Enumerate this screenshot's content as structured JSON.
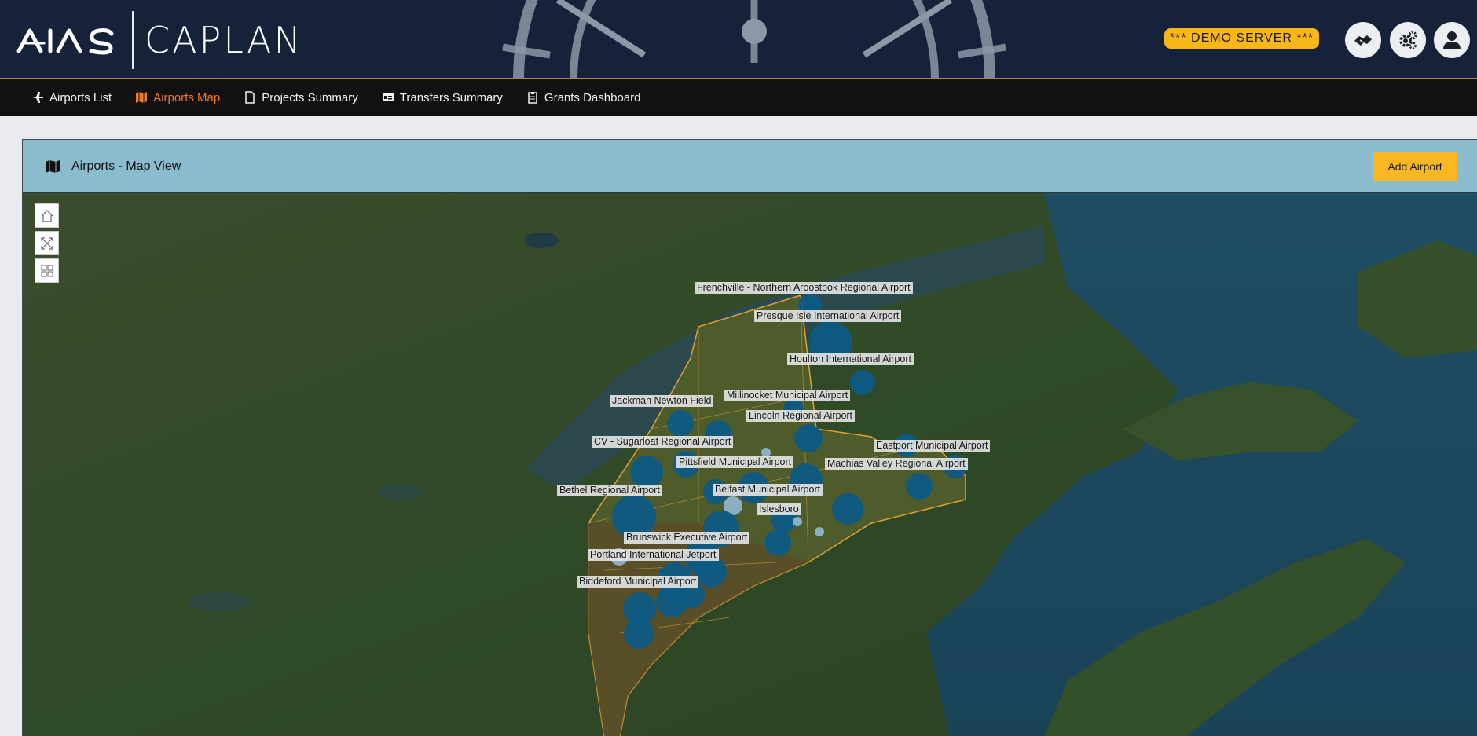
{
  "header": {
    "logo_text": "AIAS",
    "app_name": "CAPLAN",
    "demo_badge": "*** DEMO SERVER ***",
    "buttons": [
      {
        "name": "transfer-button",
        "icon": "handshake-icon"
      },
      {
        "name": "settings-button",
        "icon": "gears-icon"
      },
      {
        "name": "user-button",
        "icon": "user-icon"
      }
    ]
  },
  "nav": {
    "items": [
      {
        "label": "Airports List",
        "icon": "plane-icon",
        "active": false
      },
      {
        "label": "Airports Map",
        "icon": "map-icon",
        "active": true
      },
      {
        "label": "Projects Summary",
        "icon": "document-icon",
        "active": false
      },
      {
        "label": "Transfers Summary",
        "icon": "id-card-icon",
        "active": false
      },
      {
        "label": "Grants Dashboard",
        "icon": "clipboard-icon",
        "active": false
      }
    ]
  },
  "card": {
    "title": "Airports - Map View",
    "title_icon": "map-icon",
    "add_button": "Add Airport"
  },
  "map": {
    "controls": [
      {
        "name": "home-control",
        "icon": "home-icon"
      },
      {
        "name": "fullscreen-control",
        "icon": "expand-icon"
      },
      {
        "name": "basemap-control",
        "icon": "grid-icon"
      }
    ],
    "airports": [
      "Frenchville - Northern Aroostook Regional Airport",
      "Presque Isle International Airport",
      "Houlton International Airport",
      "Jackman Newton Field",
      "Millinocket Municipal Airport",
      "Lincoln Regional Airport",
      "CV - Sugarloaf Regional Airport",
      "Eastport Municipal Airport",
      "Pittsfield Municipal Airport",
      "Machias Valley Regional Airport",
      "Bethel Regional Airport",
      "Belfast Municipal Airport",
      "Islesboro",
      "Brunswick Executive Airport",
      "Portland International Jetport",
      "Biddeford Municipal Airport"
    ]
  },
  "colors": {
    "header_bg": "#16223a",
    "nav_bg": "#111111",
    "nav_active": "#f07a2a",
    "accent_yellow": "#f8b723",
    "card_header": "#8bbccd",
    "bubble": "#0c5a86"
  }
}
